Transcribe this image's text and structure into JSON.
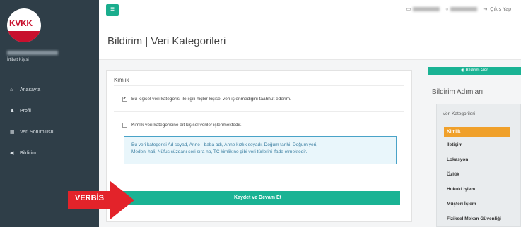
{
  "sidebar": {
    "logo_text": "KVKK",
    "user_role": "İrtibat Kişisi",
    "items": [
      {
        "icon": "home-icon",
        "glyph": "⌂",
        "label": "Anasayfa"
      },
      {
        "icon": "user-icon",
        "glyph": "♟",
        "label": "Profil"
      },
      {
        "icon": "document-icon",
        "glyph": "▦",
        "label": "Veri Sorumlusu"
      },
      {
        "icon": "megaphone-icon",
        "glyph": "◀",
        "label": "Bildirim"
      }
    ]
  },
  "topbar": {
    "menu_glyph": "≡",
    "logout_label": "Çıkış Yap"
  },
  "page": {
    "title": "Bildirim | Veri Kategorileri"
  },
  "card": {
    "header": "Kimlik",
    "option1": "Bu kişisel veri kategorisi ile ilgili hiçbir kişisel veri işlenmediğini taahhüt ederim.",
    "option1_checked": "✔",
    "option2": "Kimlik veri kategorisine ait kişisel veriler işlenmektedir.",
    "info_line1": "Bu veri kategorisi Ad soyad, Anne - baba adı, Anne kızlık soyadı, Doğum tarihi, Doğum yeri,",
    "info_line2": "Medeni hali, Nüfus cüzdanı seri sıra no, TC kimlik no gibi veri türlerini ifade etmektedir.",
    "save_label": "Kaydet ve Devam Et"
  },
  "annotation": {
    "label": "VERBİS",
    "color": "#e3232a"
  },
  "right_panel": {
    "view_button": "◉ Bildirim Gör",
    "steps_title": "Bildirim Adımları",
    "steps_subtitle": "Veri Kategorileri",
    "steps": [
      "Kimlik",
      "İletişim",
      "Lokasyon",
      "Özlük",
      "Hukuki İşlem",
      "Müşteri İşlem",
      "Fiziksel Mekan Güvenliği"
    ],
    "active_step": "Kimlik"
  },
  "colors": {
    "sidebar": "#2f3e48",
    "accent": "#1ab394",
    "active_step": "#f0a02a",
    "info_border": "#4aa3c8"
  }
}
